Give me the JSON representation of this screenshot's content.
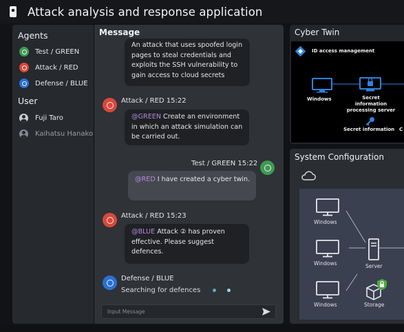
{
  "app": {
    "title": "Attack analysis and response application"
  },
  "sidebar": {
    "agents_title": "Agents",
    "agents": [
      {
        "label": "Test / GREEN",
        "color": "#3f9a52"
      },
      {
        "label": "Attack / RED",
        "color": "#d9483b"
      },
      {
        "label": "Defense / BLUE",
        "color": "#2a71d1"
      }
    ],
    "user_title": "User",
    "users": [
      {
        "label": "Fuji Taro"
      },
      {
        "label": "Kaihatsu Hanako"
      }
    ]
  },
  "messages": {
    "header": "Message",
    "items": [
      {
        "text": "An attack that uses spoofed login pages to steal credentials and exploits the SSH vulnerability to gain access to cloud secrets"
      },
      {
        "meta": "Attack / RED 15:22",
        "mention": "@GREEN",
        "text": " Create an environment in which an attack simulation can be carried out."
      },
      {
        "meta": "Test / GREEN 15:22",
        "mention": "@RED",
        "text": " I have created a cyber twin."
      },
      {
        "meta": "Attack / RED 15:23",
        "mention": "@BLUE",
        "text": " Attack ② has proven effective. Please suggest defences."
      },
      {
        "meta": "Defense / BLUE",
        "text": "Searching for defences"
      }
    ],
    "input_placeholder": "Input Message"
  },
  "cyber_twin": {
    "title": "Cyber Twin",
    "id_label": "ID access management",
    "windows_label": "Windows",
    "secret_server_label": "Secret information processing server",
    "secret_info_label": "Secret information",
    "cut_label": "C"
  },
  "system_config": {
    "title": "System Configuration",
    "windows_labels": [
      "Windows",
      "Windows",
      "Windows"
    ],
    "server_label": "Server",
    "storage_label": "Storage"
  }
}
